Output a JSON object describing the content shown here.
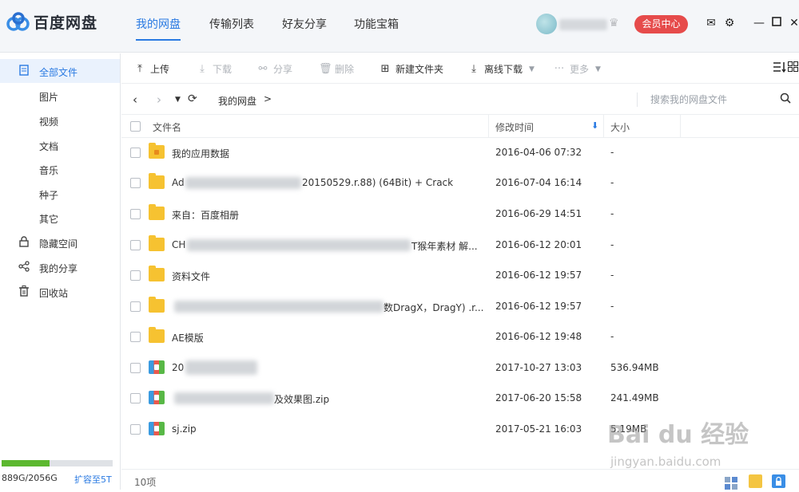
{
  "app": {
    "name": "百度网盘"
  },
  "nav": {
    "tabs": [
      "我的网盘",
      "传输列表",
      "好友分享",
      "功能宝箱"
    ]
  },
  "account": {
    "vip_button": "会员中心"
  },
  "sidebar": {
    "items": [
      {
        "label": "全部文件",
        "icon": "file-icon"
      },
      {
        "label": "图片"
      },
      {
        "label": "视频"
      },
      {
        "label": "文档"
      },
      {
        "label": "音乐"
      },
      {
        "label": "种子"
      },
      {
        "label": "其它"
      },
      {
        "label": "隐藏空间",
        "icon": "lock-icon"
      },
      {
        "label": "我的分享",
        "icon": "share-icon"
      },
      {
        "label": "回收站",
        "icon": "trash-icon"
      }
    ],
    "quota_text": "889G/2056G",
    "quota_used_fraction": 0.43,
    "expand_label": "扩容至5T"
  },
  "toolbar": {
    "upload": "上传",
    "download": "下载",
    "share": "分享",
    "delete": "删除",
    "new_folder": "新建文件夹",
    "offline_download": "离线下载",
    "more": "更多"
  },
  "address": {
    "breadcrumb": "我的网盘",
    "separator": ">",
    "search_placeholder": "搜索我的网盘文件"
  },
  "table": {
    "headers": {
      "name": "文件名",
      "modified": "修改时间",
      "size": "大小"
    },
    "rows": [
      {
        "name": "我的应用数据",
        "date": "2016-04-06 07:32",
        "size": "-",
        "type": "app-folder"
      },
      {
        "name": "Ad",
        "name_tail": "20150529.r.88) (64Bit) + Crack",
        "date": "2016-07-04 16:14",
        "size": "-",
        "type": "folder"
      },
      {
        "name": "来自：百度相册",
        "date": "2016-06-29 14:51",
        "size": "-",
        "type": "folder"
      },
      {
        "name": "CH",
        "name_tail": "T猴年素材 解...",
        "date": "2016-06-12 20:01",
        "size": "-",
        "type": "folder"
      },
      {
        "name": "资料文件",
        "date": "2016-06-12 19:57",
        "size": "-",
        "type": "folder"
      },
      {
        "name": "",
        "name_tail": "数DragX，DragY) .r...",
        "date": "2016-06-12 19:57",
        "size": "-",
        "type": "folder"
      },
      {
        "name": "AE模版",
        "date": "2016-06-12 19:48",
        "size": "-",
        "type": "folder"
      },
      {
        "name": "20",
        "date": "2017-10-27 13:03",
        "size": "536.94MB",
        "type": "zip"
      },
      {
        "name": "",
        "name_tail": "及效果图.zip",
        "date": "2017-06-20 15:58",
        "size": "241.49MB",
        "type": "zip"
      },
      {
        "name": "sj.zip",
        "date": "2017-05-21 16:03",
        "size": "5.19MB",
        "type": "zip"
      }
    ]
  },
  "footer": {
    "count": "10项"
  },
  "watermark": {
    "main": "Bai du 经验",
    "sub": "jingyan.baidu.com"
  },
  "colors": {
    "accent": "#2a7ae2",
    "vip": "#e64b4b",
    "folder": "#f6c231",
    "quota": "#5cb82f"
  }
}
